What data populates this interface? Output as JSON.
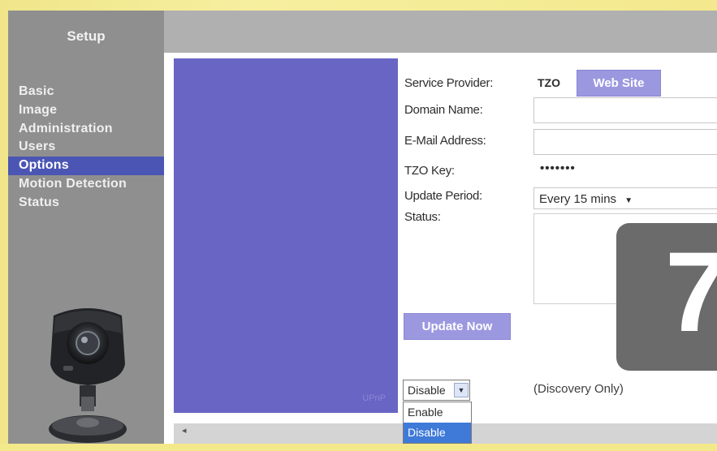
{
  "sidebar": {
    "title": "Setup",
    "items": [
      {
        "label": "Basic"
      },
      {
        "label": "Image"
      },
      {
        "label": "Administration"
      },
      {
        "label": "Users"
      },
      {
        "label": "Options",
        "active": true
      },
      {
        "label": "Motion Detection"
      },
      {
        "label": "Status"
      }
    ]
  },
  "form": {
    "service_provider_label": "Service Provider:",
    "service_provider_value": "TZO",
    "website_button": "Web Site",
    "domain_label": "Domain Name:",
    "domain_value": "",
    "email_label": "E-Mail Address:",
    "email_value": "",
    "tzo_key_label": "TZO Key:",
    "tzo_key_value": "•••••••",
    "update_period_label": "Update Period:",
    "update_period_value": "Every 15 mins",
    "status_label": "Status:",
    "update_now_button": "Update Now"
  },
  "badge": {
    "number": "7"
  },
  "panel": {
    "ghost_text": "UPnP"
  },
  "discovery": {
    "select_value": "Disable",
    "options": [
      "Enable",
      "Disable"
    ],
    "selected_option": "Disable",
    "note": "(Discovery Only)"
  },
  "colors": {
    "sidebar_bg": "#8f8f8f",
    "active_item": "#4b55b3",
    "purple_panel": "#6965c4",
    "button": "#9c98e0",
    "badge_bg": "#6b6b6b",
    "background": "#f3e98a"
  },
  "icons": {
    "camera": "webcam-device-icon",
    "dropdown": "chevron-down-icon"
  }
}
